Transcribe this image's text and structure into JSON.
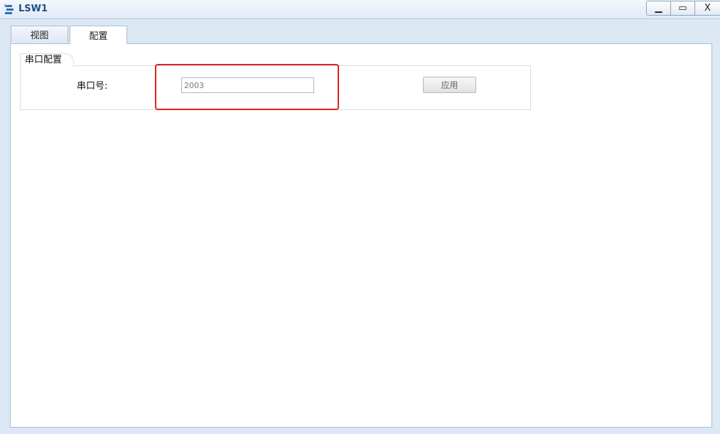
{
  "window": {
    "title": "LSW1",
    "minimize_glyph": "▁",
    "maximize_glyph": "▭",
    "close_glyph": "X"
  },
  "tabs": [
    {
      "label": "视图"
    },
    {
      "label": "配置"
    }
  ],
  "serial_config": {
    "group_title": "串口配置",
    "port_label": "串口号:",
    "port_value": "2003",
    "apply_label": "应用"
  },
  "colors": {
    "highlight": "#e02020",
    "title_text": "#1f4d84"
  }
}
